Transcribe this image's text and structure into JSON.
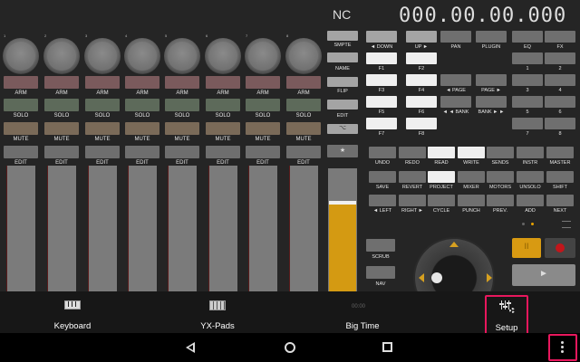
{
  "header": {
    "timecode": "000.00.00.000",
    "indicator": "NC"
  },
  "channels": [
    {
      "num": "1",
      "arm": "ARM",
      "solo": "SOLO",
      "mute": "MUTE",
      "edit": "EDIT"
    },
    {
      "num": "2",
      "arm": "ARM",
      "solo": "SOLO",
      "mute": "MUTE",
      "edit": "EDIT"
    },
    {
      "num": "3",
      "arm": "ARM",
      "solo": "SOLO",
      "mute": "MUTE",
      "edit": "EDIT"
    },
    {
      "num": "4",
      "arm": "ARM",
      "solo": "SOLO",
      "mute": "MUTE",
      "edit": "EDIT"
    },
    {
      "num": "5",
      "arm": "ARM",
      "solo": "SOLO",
      "mute": "MUTE",
      "edit": "EDIT"
    },
    {
      "num": "6",
      "arm": "ARM",
      "solo": "SOLO",
      "mute": "MUTE",
      "edit": "EDIT"
    },
    {
      "num": "7",
      "arm": "ARM",
      "solo": "SOLO",
      "mute": "MUTE",
      "edit": "EDIT"
    },
    {
      "num": "8",
      "arm": "ARM",
      "solo": "SOLO",
      "mute": "MUTE",
      "edit": "EDIT"
    }
  ],
  "master_strip": {
    "smpte": "SMPTE",
    "name": "NAME",
    "flip": "FLIP",
    "edit": "EDIT",
    "cc_icon": "⌥",
    "star": "★"
  },
  "scrub_panel": {
    "scrub": "SCRUB",
    "nav": "NAV",
    "dots": "· ·"
  },
  "bank_buttons": {
    "row1": [
      "◄ DOWN",
      "UP ►",
      "PAN",
      "PLUGIN",
      "EQ",
      "FX"
    ],
    "fn": [
      "F1",
      "F2",
      "F3",
      "F4",
      "F5",
      "F6",
      "F7",
      "F8"
    ],
    "page_prev": "◄ PAGE",
    "page_next": "PAGE ►",
    "bank_prev": "◄ ◄ BANK",
    "bank_next": "BANK ► ►",
    "numbers": [
      "1",
      "2",
      "3",
      "4",
      "5",
      "6",
      "7",
      "8"
    ]
  },
  "command_rows": [
    [
      "UNDO",
      "REDO",
      "READ",
      "WRITE",
      "SENDS",
      "INSTR",
      "MASTER"
    ],
    [
      "SAVE",
      "REVERT",
      "PROJECT",
      "MIXER",
      "MOTORS",
      "UNSOLO",
      "SHIFT"
    ],
    [
      "◄ LEFT",
      "RIGHT ►",
      "CYCLE",
      "PUNCH",
      "PREV.",
      "ADD",
      "NEXT"
    ]
  ],
  "transport": {
    "pause": "II",
    "play": "►",
    "time_small": "00:00"
  },
  "bottom_tabs": [
    {
      "label": "Keyboard",
      "icon": "keyboard-icon"
    },
    {
      "label": "YX-Pads",
      "icon": "pads-icon"
    },
    {
      "label": "Big Time",
      "icon": "clock-icon"
    },
    {
      "label": "Setup",
      "icon": "mixer-settings-icon"
    }
  ],
  "colors": {
    "accent": "#e8a200",
    "highlight": "#e8175d",
    "record": "#c2161b"
  }
}
